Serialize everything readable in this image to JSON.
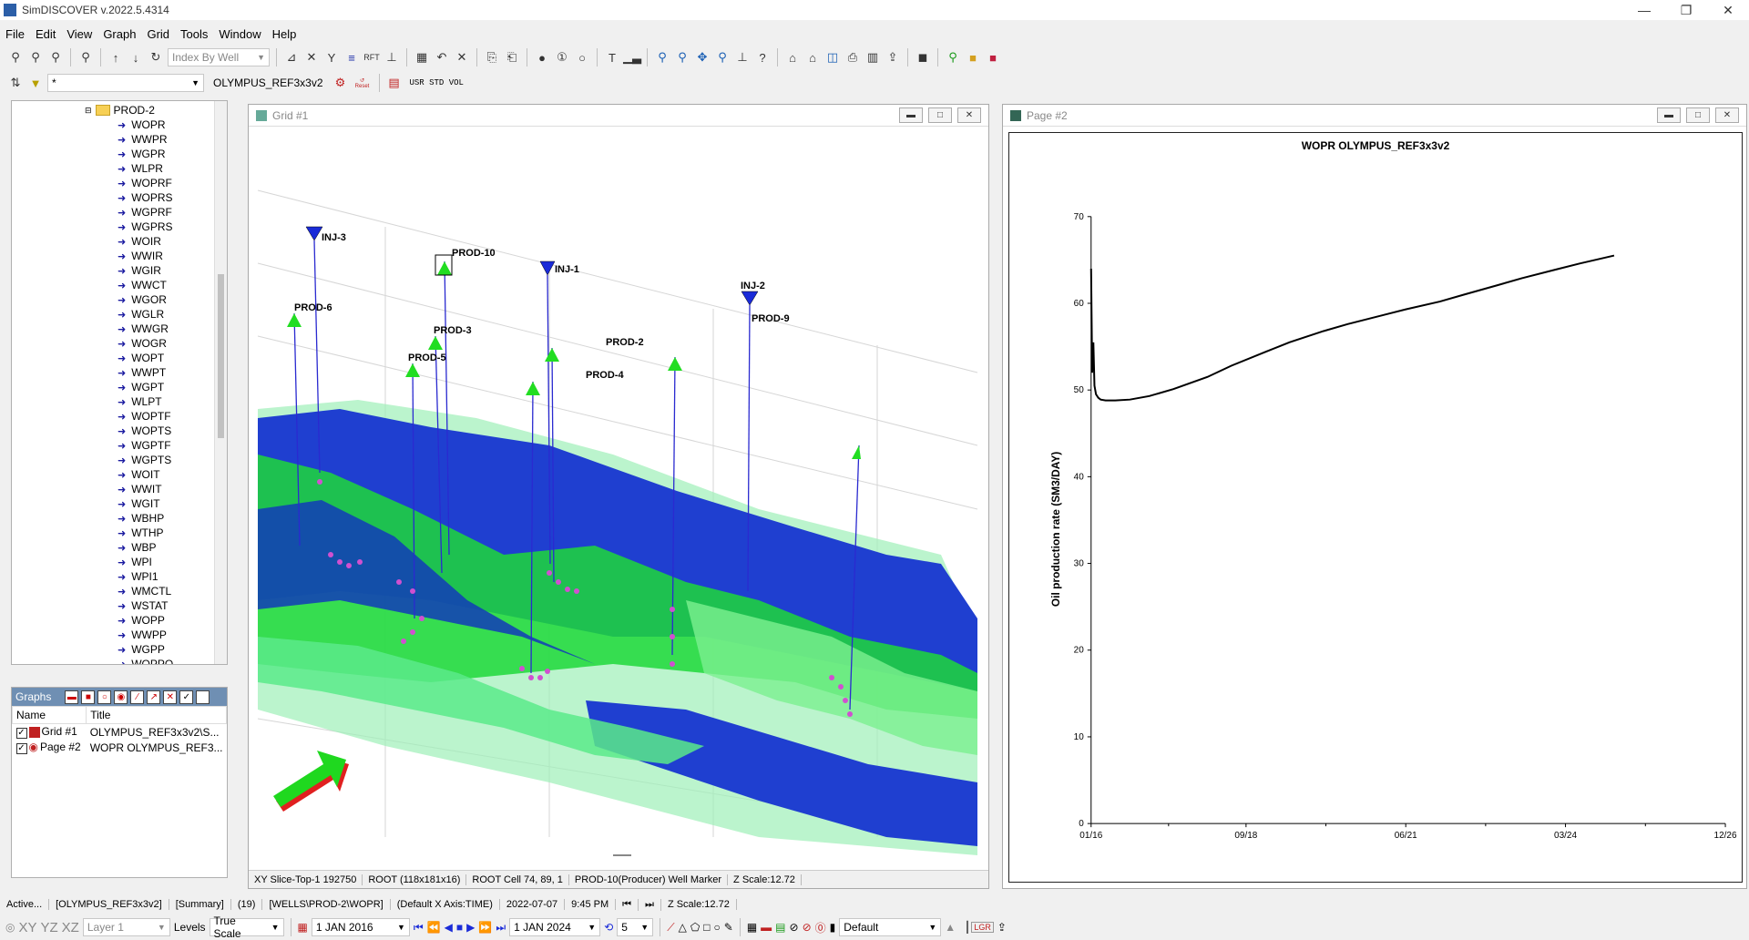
{
  "app": {
    "title": "SimDISCOVER v.2022.5.4314"
  },
  "menu": [
    "File",
    "Edit",
    "View",
    "Graph",
    "Grid",
    "Tools",
    "Window",
    "Help"
  ],
  "toolbar": {
    "index_combo": "Index By Well",
    "filter_value": "*",
    "model_name": "OLYMPUS_REF3x3v2",
    "reset_label": "Reset",
    "units": "USR STD VOL",
    "rft_label": "RFT"
  },
  "tree": {
    "folder": "PROD-2",
    "items": [
      "WOPR",
      "WWPR",
      "WGPR",
      "WLPR",
      "WOPRF",
      "WOPRS",
      "WGPRF",
      "WGPRS",
      "WOIR",
      "WWIR",
      "WGIR",
      "WWCT",
      "WGOR",
      "WGLR",
      "WWGR",
      "WOGR",
      "WOPT",
      "WWPT",
      "WGPT",
      "WLPT",
      "WOPTF",
      "WOPTS",
      "WGPTF",
      "WGPTS",
      "WOIT",
      "WWIT",
      "WGIT",
      "WBHP",
      "WTHP",
      "WBP",
      "WPI",
      "WPI1",
      "WMCTL",
      "WSTAT",
      "WOPP",
      "WWPP",
      "WGPP",
      "WOPPO"
    ]
  },
  "graphs_panel": {
    "title": "Graphs",
    "columns": [
      "Name",
      "Title"
    ],
    "rows": [
      {
        "name": "Grid #1",
        "title": "OLYMPUS_REF3x3v2\\S..."
      },
      {
        "name": "Page #2",
        "title": "WOPR OLYMPUS_REF3..."
      }
    ]
  },
  "grid_window": {
    "title": "Grid #1",
    "wells": [
      "INJ-3",
      "PROD-10",
      "INJ-2",
      "INJ-1",
      "PROD-6",
      "PROD-3",
      "PROD-5",
      "PROD-2",
      "PROD-4",
      "PROD-9"
    ],
    "status": [
      "XY Slice-Top-1 192750",
      "ROOT (118x181x16)",
      "ROOT Cell 74, 89, 1",
      "PROD-10(Producer) Well Marker",
      "Z Scale:12.72"
    ]
  },
  "page_window": {
    "title": "Page #2"
  },
  "chart_data": {
    "type": "line",
    "title": "WOPR OLYMPUS_REF3x3v2",
    "xlabel": "",
    "ylabel": "Oil production rate (SM3/DAY)",
    "ylim": [
      0,
      70
    ],
    "yticks": [
      0,
      10,
      20,
      30,
      40,
      50,
      60,
      70
    ],
    "x_tick_labels": [
      "01/16",
      "09/18",
      "06/21",
      "03/24",
      "12/26"
    ],
    "x_tick_dates": [
      "2016-01-01",
      "2018-09-01",
      "2021-06-01",
      "2024-03-01",
      "2026-12-01"
    ],
    "xlim": [
      "2016-01-01",
      "2026-12-01"
    ],
    "series": [
      {
        "x": [
          "2016-01-01",
          "2016-01-08",
          "2016-01-15",
          "2016-01-22",
          "2016-02-01",
          "2016-02-15",
          "2016-03-01",
          "2016-04-01",
          "2016-06-01",
          "2016-09-01",
          "2017-01-01",
          "2017-06-01",
          "2018-01-01",
          "2018-06-01",
          "2019-01-01",
          "2019-06-01",
          "2020-01-01",
          "2020-06-01",
          "2021-01-01",
          "2021-06-01",
          "2022-01-01",
          "2022-06-01",
          "2023-01-01",
          "2023-06-01",
          "2024-01-01",
          "2024-06-01",
          "2025-01-01"
        ],
        "values": [
          64,
          52,
          55.5,
          50.5,
          49.5,
          49.1,
          48.9,
          48.8,
          48.8,
          48.9,
          49.3,
          50.1,
          51.5,
          52.8,
          54.4,
          55.5,
          56.8,
          57.6,
          58.6,
          59.3,
          60.2,
          61.0,
          62.1,
          62.9,
          63.9,
          64.6,
          65.5
        ]
      }
    ],
    "grid": false
  },
  "statusbar": [
    "Active...",
    "[OLYMPUS_REF3x3v2]",
    "[Summary]",
    "(19)",
    "[WELLS\\PROD-2\\WOPR]",
    "(Default X Axis:TIME)",
    "2022-07-07",
    "9:45 PM",
    "Z Scale:12.72"
  ],
  "bottombar": {
    "views": [
      "XY",
      "YZ",
      "XZ"
    ],
    "layer": "Layer 1",
    "levels": "Levels",
    "scale": "True Scale",
    "start_date": "1 JAN 2016",
    "end_date": "1 JAN 2024",
    "step": "5",
    "default_label": "Default",
    "lgr_label": "LGR"
  }
}
